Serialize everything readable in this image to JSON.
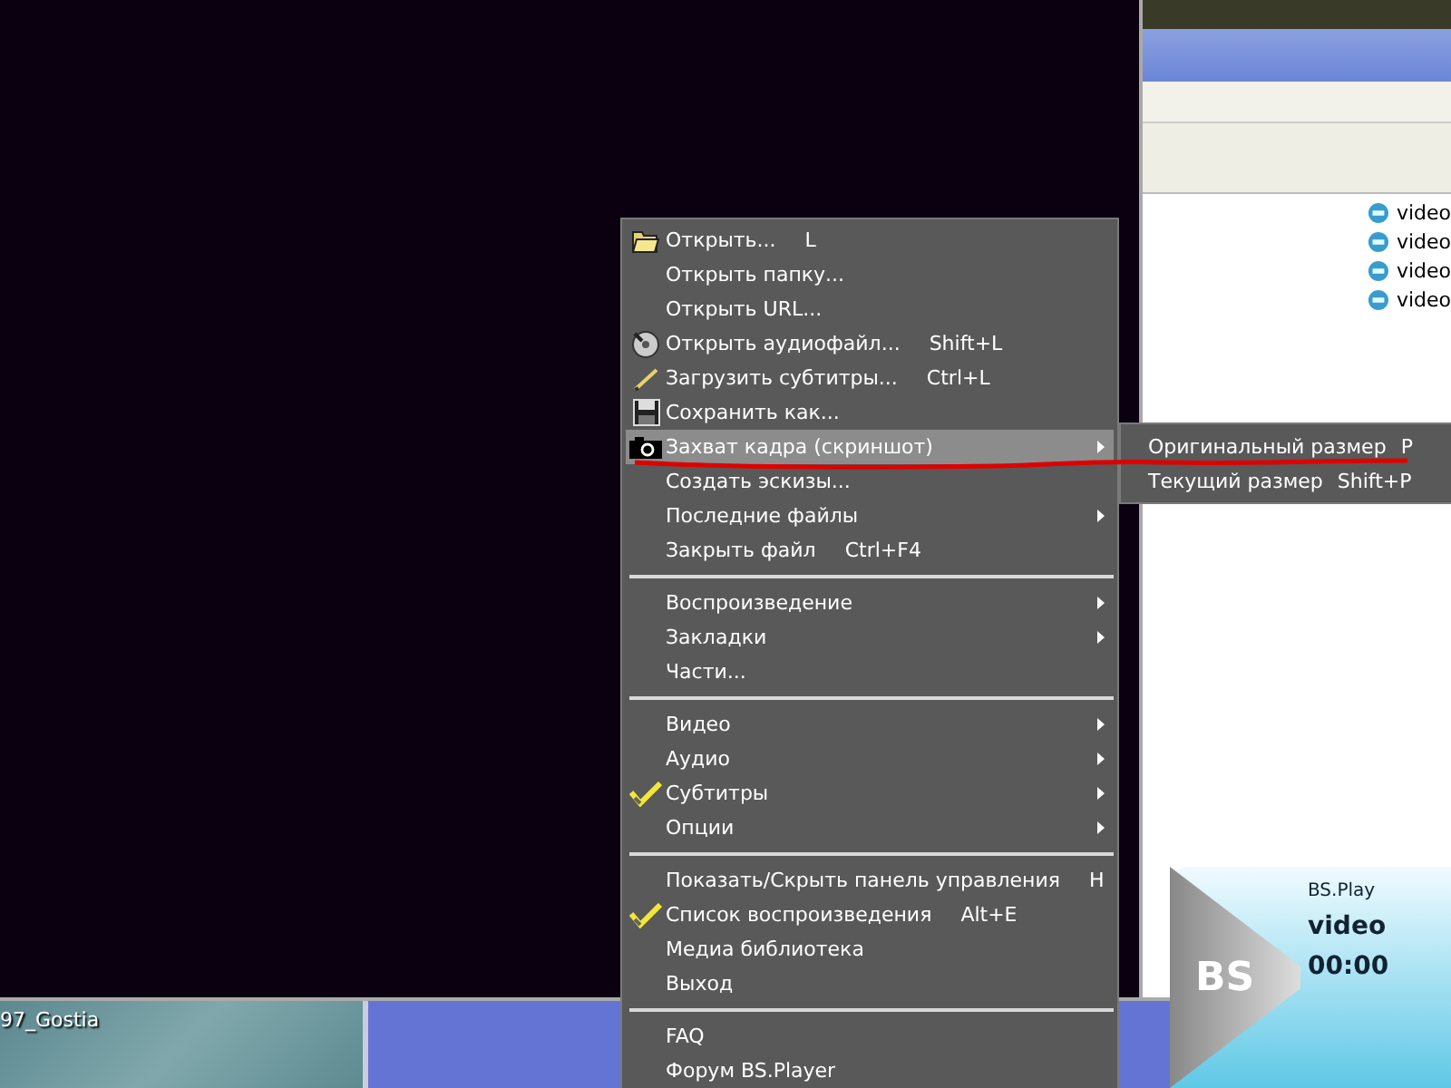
{
  "desktop": {
    "file_label": "97_Gostia"
  },
  "list_window": {
    "items": [
      {
        "label": "video"
      },
      {
        "label": "video"
      },
      {
        "label": "video"
      },
      {
        "label": "video"
      }
    ]
  },
  "player_widget": {
    "logo": "BS",
    "title": "BS.Play",
    "file": "video",
    "time": "00:00"
  },
  "context_menu": {
    "items": [
      {
        "kind": "item",
        "label": "Открыть...",
        "shortcut": "L",
        "submenu": false,
        "checked": false,
        "selected": false
      },
      {
        "kind": "item",
        "label": "Открыть папку...",
        "submenu": false,
        "checked": false,
        "selected": false
      },
      {
        "kind": "item",
        "label": "Открыть URL...",
        "submenu": false,
        "checked": false,
        "selected": false
      },
      {
        "kind": "item",
        "label": "Открыть аудиофайл...",
        "shortcut": "Shift+L",
        "submenu": false,
        "checked": false,
        "selected": false
      },
      {
        "kind": "item",
        "label": "Загрузить субтитры...",
        "shortcut": "Ctrl+L",
        "submenu": false,
        "checked": false,
        "selected": false
      },
      {
        "kind": "item",
        "label": "Сохранить как...",
        "submenu": false,
        "checked": false,
        "selected": false
      },
      {
        "kind": "item",
        "label": "Захват кадра (скриншот)",
        "submenu": true,
        "checked": false,
        "selected": true
      },
      {
        "kind": "item",
        "label": "Создать эскизы...",
        "submenu": false,
        "checked": false,
        "selected": false
      },
      {
        "kind": "item",
        "label": "Последние файлы",
        "submenu": true,
        "checked": false,
        "selected": false
      },
      {
        "kind": "item",
        "label": "Закрыть файл",
        "shortcut": "Ctrl+F4",
        "submenu": false,
        "checked": false,
        "selected": false
      },
      {
        "kind": "separator"
      },
      {
        "kind": "item",
        "label": "Воспроизведение",
        "submenu": true,
        "checked": false,
        "selected": false
      },
      {
        "kind": "item",
        "label": "Закладки",
        "submenu": true,
        "checked": false,
        "selected": false
      },
      {
        "kind": "item",
        "label": "Части...",
        "submenu": false,
        "checked": false,
        "selected": false
      },
      {
        "kind": "separator"
      },
      {
        "kind": "item",
        "label": "Видео",
        "submenu": true,
        "checked": false,
        "selected": false
      },
      {
        "kind": "item",
        "label": "Аудио",
        "submenu": true,
        "checked": false,
        "selected": false
      },
      {
        "kind": "item",
        "label": "Субтитры",
        "submenu": true,
        "checked": true,
        "selected": false
      },
      {
        "kind": "item",
        "label": "Опции",
        "submenu": true,
        "checked": false,
        "selected": false
      },
      {
        "kind": "separator"
      },
      {
        "kind": "item",
        "label": "Показать/Скрыть панель управления",
        "shortcut": "H",
        "submenu": false,
        "checked": false,
        "selected": false
      },
      {
        "kind": "item",
        "label": "Список воспроизведения",
        "shortcut": "Alt+E",
        "submenu": false,
        "checked": true,
        "selected": false
      },
      {
        "kind": "item",
        "label": "Медиа библиотека",
        "submenu": false,
        "checked": false,
        "selected": false
      },
      {
        "kind": "item",
        "label": "Выход",
        "submenu": false,
        "checked": false,
        "selected": false
      },
      {
        "kind": "separator"
      },
      {
        "kind": "item",
        "label": "FAQ",
        "submenu": false,
        "checked": false,
        "selected": false
      },
      {
        "kind": "item",
        "label": "Форум BS.Player",
        "submenu": false,
        "checked": false,
        "selected": false
      }
    ]
  },
  "submenu": {
    "items": [
      {
        "label": "Оригинальный размер",
        "shortcut": "P",
        "selected": false
      },
      {
        "label": "Текущий размер",
        "shortcut": "Shift+P",
        "selected": false
      }
    ]
  }
}
